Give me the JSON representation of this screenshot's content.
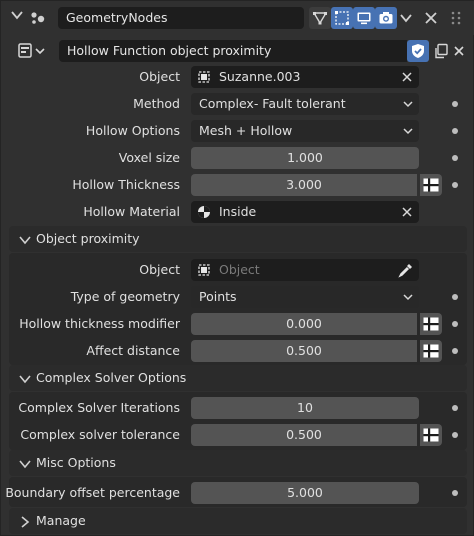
{
  "header": {
    "modifier_name": "GeometryNodes"
  },
  "modifier": {
    "title": "Hollow Function object proximity"
  },
  "main": {
    "object": {
      "label": "Object",
      "value": "Suzanne.003"
    },
    "method": {
      "label": "Method",
      "value": "Complex- Fault tolerant"
    },
    "hollow_options": {
      "label": "Hollow Options",
      "value": "Mesh + Hollow"
    },
    "voxel_size": {
      "label": "Voxel size",
      "value": "1.000"
    },
    "hollow_thickness": {
      "label": "Hollow Thickness",
      "value": "3.000"
    },
    "hollow_material": {
      "label": "Hollow Material",
      "value": "Inside"
    }
  },
  "object_proximity": {
    "title": "Object proximity",
    "object": {
      "label": "Object",
      "placeholder": "Object"
    },
    "type_of_geometry": {
      "label": "Type of geometry",
      "value": "Points"
    },
    "hollow_thickness_modifier": {
      "label": "Hollow thickness modifier",
      "value": "0.000"
    },
    "affect_distance": {
      "label": "Affect distance",
      "value": "0.500"
    }
  },
  "complex_solver": {
    "title": "Complex Solver Options",
    "iterations": {
      "label": "Complex Solver Iterations",
      "value": "10"
    },
    "tolerance": {
      "label": "Complex solver tolerance",
      "value": "0.500"
    }
  },
  "misc": {
    "title": "Misc Options",
    "boundary_offset": {
      "label": "Boundary offset percentage",
      "value": "5.000"
    }
  },
  "manage": {
    "title": "Manage"
  },
  "colors": {
    "accent": "#4772b3",
    "panel_bg": "#303030",
    "field_bg": "#545454",
    "dark_field_bg": "#1d1d1d"
  }
}
